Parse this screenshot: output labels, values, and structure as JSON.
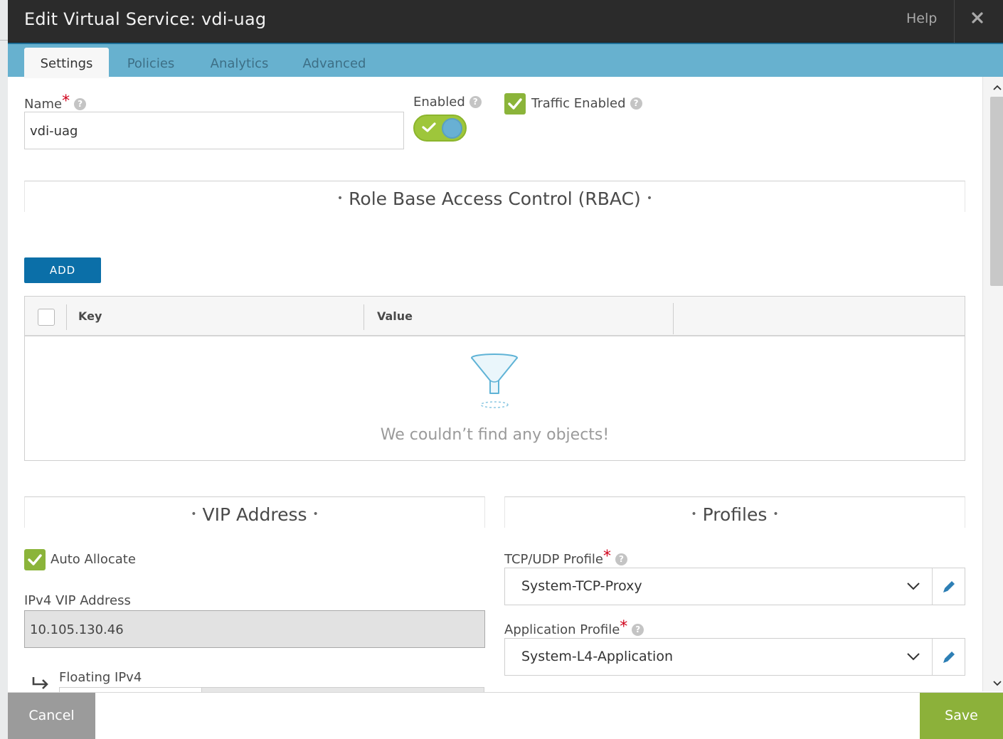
{
  "dialog": {
    "title": "Edit Virtual Service: vdi-uag",
    "help_label": "Help",
    "close_icon": "close-icon"
  },
  "tabs": [
    {
      "label": "Settings",
      "active": true
    },
    {
      "label": "Policies",
      "active": false
    },
    {
      "label": "Analytics",
      "active": false
    },
    {
      "label": "Advanced",
      "active": false
    }
  ],
  "settings": {
    "name_label": "Name",
    "name_value": "vdi-uag",
    "enabled_label": "Enabled",
    "enabled": true,
    "traffic_enabled_label": "Traffic Enabled",
    "traffic_enabled": true
  },
  "rbac": {
    "title": "Role Base Access Control (RBAC)",
    "add_label": "ADD",
    "columns": [
      "Key",
      "Value"
    ],
    "empty_text": "We couldn’t find any objects!"
  },
  "vip": {
    "title": "VIP Address",
    "auto_allocate_label": "Auto Allocate",
    "auto_allocate": true,
    "ipv4_label": "IPv4 VIP Address",
    "ipv4_value": "10.105.130.46",
    "floating_label": "Floating IPv4"
  },
  "profiles": {
    "title": "Profiles",
    "tcp_udp_label": "TCP/UDP Profile",
    "tcp_udp_value": "System-TCP-Proxy",
    "app_label": "Application Profile",
    "app_value": "System-L4-Application"
  },
  "footer": {
    "cancel_label": "Cancel",
    "save_label": "Save"
  },
  "colors": {
    "accent_blue": "#0b6fa8",
    "tab_bar": "#67b1cf",
    "save_green": "#8cb13a",
    "cancel_gray": "#9b9b9b",
    "required_red": "#d0021b"
  }
}
